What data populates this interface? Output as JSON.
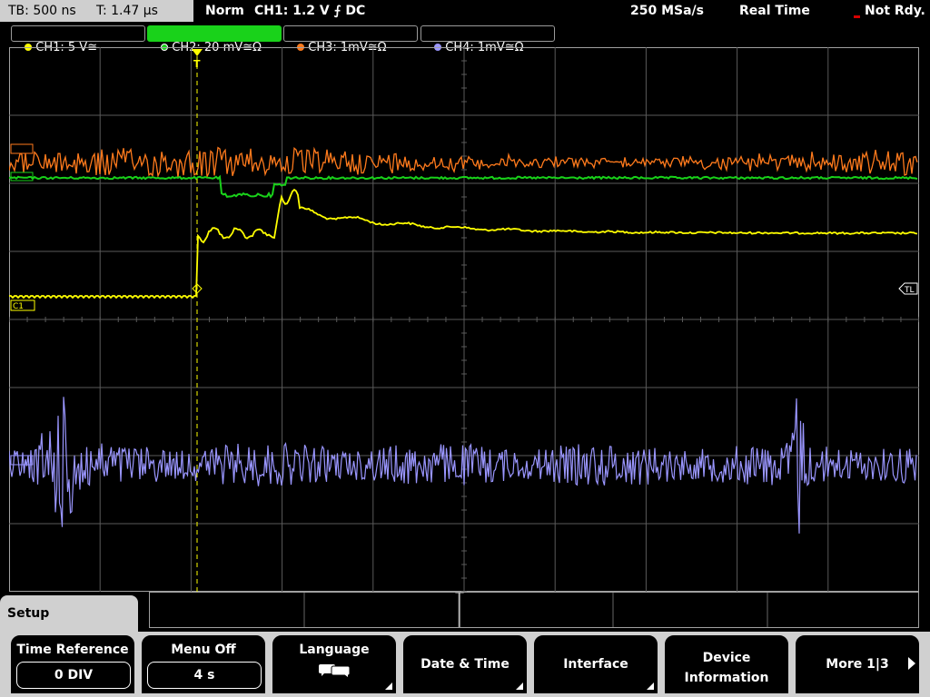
{
  "status": {
    "timebase": "TB: 500 ns",
    "trigger_time": "T: 1.47 µs",
    "trigger_mode": "Norm",
    "trigger_source": "CH1: 1.2 V ⨍ DC",
    "sample_rate": "250 MSa/s",
    "acq_mode": "Real Time",
    "state": "Not Rdy."
  },
  "channels": [
    {
      "label": "CH1: 5 V≅",
      "color": "#ffff00",
      "active": false
    },
    {
      "label": "CH2: 20 mV≅Ω",
      "color": "#19d21a",
      "active": true
    },
    {
      "label": "CH3: 1mV≅Ω",
      "color": "#ff7a1c",
      "active": false
    },
    {
      "label": "CH4: 1mV≅Ω",
      "color": "#9a96ff",
      "active": false
    }
  ],
  "markers": {
    "ch1": "C1",
    "trigger_level": "TL",
    "trigger_position": "T"
  },
  "menu": {
    "title": "Setup",
    "softkeys": [
      {
        "label": "Time Reference",
        "value": "0 DIV"
      },
      {
        "label": "Menu Off",
        "value": "4 s"
      },
      {
        "label": "Language",
        "icon": "speech-bubbles-icon"
      },
      {
        "label": "Date & Time"
      },
      {
        "label": "Interface"
      },
      {
        "label_line1": "Device",
        "label_line2": "Information"
      },
      {
        "label": "More 1|3"
      }
    ]
  }
}
